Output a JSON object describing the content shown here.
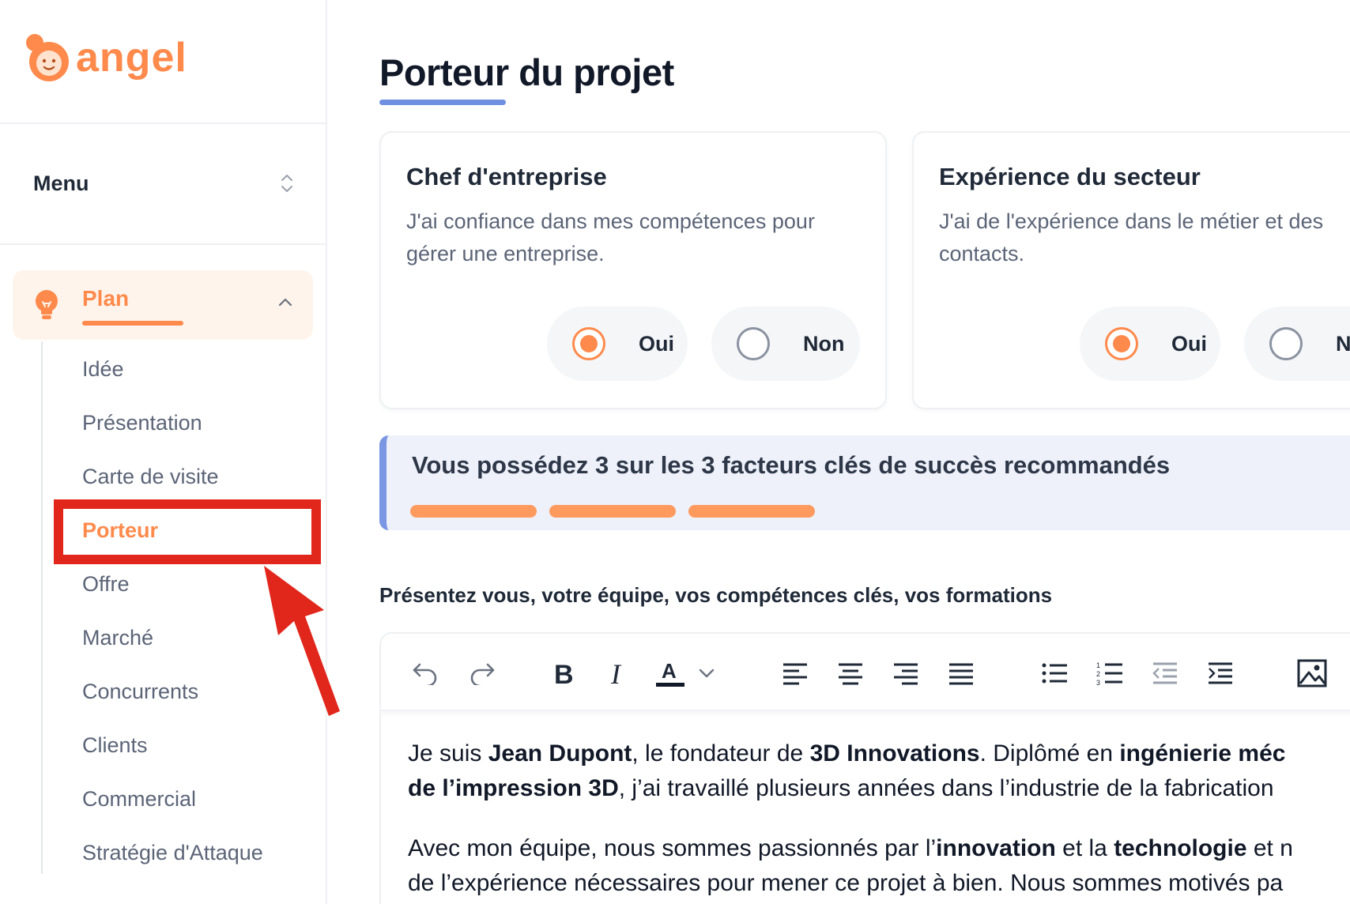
{
  "brand": {
    "name": "angel",
    "color": "#ff8a4c"
  },
  "sidebar": {
    "menu_label": "Menu",
    "section": {
      "label": "Plan",
      "icon": "lightbulb-icon"
    },
    "items": [
      {
        "label": "Idée"
      },
      {
        "label": "Présentation"
      },
      {
        "label": "Carte de visite"
      },
      {
        "label": "Porteur",
        "active": true
      },
      {
        "label": "Offre"
      },
      {
        "label": "Marché"
      },
      {
        "label": "Concurrents"
      },
      {
        "label": "Clients"
      },
      {
        "label": "Commercial"
      },
      {
        "label": "Stratégie d'Attaque"
      }
    ]
  },
  "main": {
    "title": "Porteur du projet",
    "cards": [
      {
        "title": "Chef d'entreprise",
        "description": "J'ai confiance dans mes compétences pour gérer une entreprise.",
        "options": [
          {
            "label": "Oui",
            "checked": true
          },
          {
            "label": "Non",
            "checked": false
          }
        ]
      },
      {
        "title": "Expérience du secteur",
        "description": "J'ai de l'expérience dans le métier et des contacts.",
        "options": [
          {
            "label": "Oui",
            "checked": true
          },
          {
            "label": "Non",
            "checked": false
          }
        ]
      }
    ],
    "success_banner": {
      "text": "Vous possédez 3 sur les 3 facteurs clés de succès recommandés",
      "achieved": 3,
      "total": 3
    },
    "editor": {
      "label": "Présentez vous, votre équipe, vos compétences clés, vos formations",
      "toolbar": [
        "undo-icon",
        "redo-icon",
        "bold-icon",
        "italic-icon",
        "font-color-icon",
        "chevron-down-icon",
        "align-left-icon",
        "align-center-icon",
        "align-right-icon",
        "align-justify-icon",
        "bulleted-list-icon",
        "numbered-list-icon",
        "outdent-icon",
        "indent-icon",
        "image-icon"
      ],
      "paragraphs": [
        {
          "lines": [
            [
              {
                "text": "Je suis "
              },
              {
                "text": "Jean Dupont",
                "bold": true
              },
              {
                "text": ", le fondateur de "
              },
              {
                "text": "3D Innovations",
                "bold": true
              },
              {
                "text": ". Diplômé en "
              },
              {
                "text": "ingénierie méc",
                "bold": true
              }
            ],
            [
              {
                "text": "de l’impression 3D",
                "bold": true
              },
              {
                "text": ", j’ai travaillé plusieurs années dans l’industrie de la fabrication"
              }
            ]
          ]
        },
        {
          "lines": [
            [
              {
                "text": "Avec mon équipe, nous sommes passionnés par l’"
              },
              {
                "text": "innovation",
                "bold": true
              },
              {
                "text": " et la "
              },
              {
                "text": "technologie",
                "bold": true
              },
              {
                "text": " et n"
              }
            ],
            [
              {
                "text": "de l’expérience nécessaires pour mener ce projet à bien. Nous sommes motivés pa"
              }
            ]
          ]
        }
      ]
    }
  },
  "annotation": {
    "color": "#e1261c"
  }
}
